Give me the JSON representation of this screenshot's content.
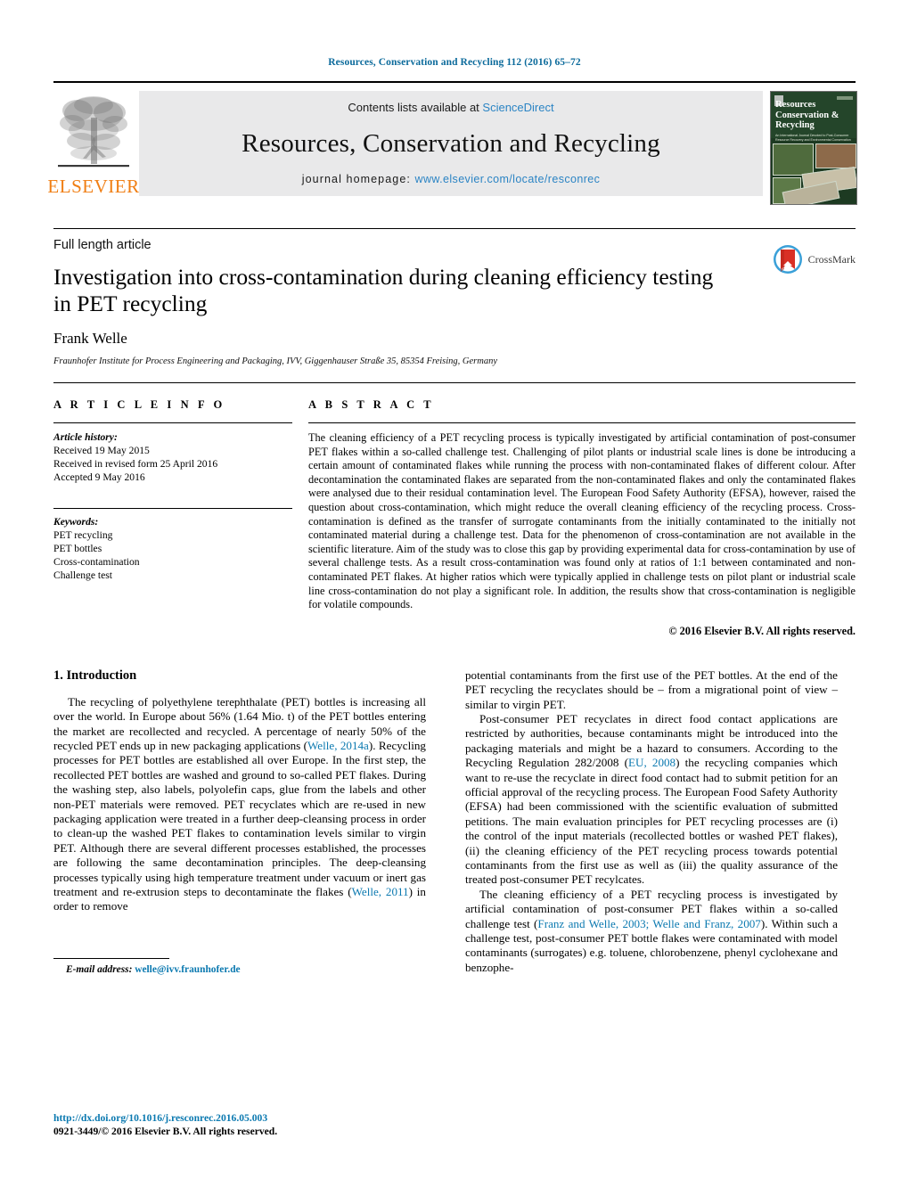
{
  "running_head": "Resources, Conservation and Recycling 112 (2016) 65–72",
  "masthead": {
    "publisher_name": "ELSEVIER",
    "contents_prefix": "Contents lists available at ",
    "contents_link": "ScienceDirect",
    "journal_title": "Resources, Conservation and Recycling",
    "homepage_prefix": "journal homepage: ",
    "homepage_url": "www.elsevier.com/locate/resconrec",
    "cover": {
      "title_line1": "Resources",
      "title_line2": "Conservation &",
      "title_line3": "Recycling",
      "subtitle": "An International Journal Devoted to Post-Consumer Resource Recovery and Environmental Conservation"
    }
  },
  "article": {
    "type": "Full length article",
    "title": "Investigation into cross-contamination during cleaning efficiency testing in PET recycling",
    "author": "Frank Welle",
    "affiliation": "Fraunhofer Institute for Process Engineering and Packaging, IVV, Giggenhauser Straße 35, 85354 Freising, Germany",
    "crossmark_label": "CrossMark"
  },
  "article_info": {
    "heading": "A R T I C L E   I N F O",
    "history_title": "Article history:",
    "history": [
      "Received 19 May 2015",
      "Received in revised form 25 April 2016",
      "Accepted 9 May 2016"
    ],
    "keywords_title": "Keywords:",
    "keywords": [
      "PET recycling",
      "PET bottles",
      "Cross-contamination",
      "Challenge test"
    ]
  },
  "abstract": {
    "heading": "A B S T R A C T",
    "text": "The cleaning efficiency of a PET recycling process is typically investigated by artificial contamination of post-consumer PET flakes within a so-called challenge test. Challenging of pilot plants or industrial scale lines is done be introducing a certain amount of contaminated flakes while running the process with non-contaminated flakes of different colour. After decontamination the contaminated flakes are separated from the non-contaminated flakes and only the contaminated flakes were analysed due to their residual contamination level. The European Food Safety Authority (EFSA), however, raised the question about cross-contamination, which might reduce the overall cleaning efficiency of the recycling process. Cross-contamination is defined as the transfer of surrogate contaminants from the initially contaminated to the initially not contaminated material during a challenge test. Data for the phenomenon of cross-contamination are not available in the scientific literature. Aim of the study was to close this gap by providing experimental data for cross-contamination by use of several challenge tests. As a result cross-contamination was found only at ratios of 1:1 between contaminated and non-contaminated PET flakes. At higher ratios which were typically applied in challenge tests on pilot plant or industrial scale line cross-contamination do not play a significant role. In addition, the results show that cross-contamination is negligible for volatile compounds.",
    "copyright": "© 2016 Elsevier B.V. All rights reserved."
  },
  "body": {
    "section_heading": "1. Introduction",
    "left_p1_a": "The recycling of polyethylene terephthalate (PET) bottles is increasing all over the world. In Europe about 56% (1.64 Mio. t) of the PET bottles entering the market are recollected and recycled. A percentage of nearly 50% of the recycled PET ends up in new packaging applications (",
    "left_p1_ref1": "Welle, 2014a",
    "left_p1_b": "). Recycling processes for PET bottles are established all over Europe. In the first step, the recollected PET bottles are washed and ground to so-called PET flakes. During the washing step, also labels, polyolefin caps, glue from the labels and other non-PET materials were removed. PET recyclates which are re-used in new packaging application were treated in a further deep-cleansing process in order to clean-up the washed PET flakes to contamination levels similar to virgin PET. Although there are several different processes established, the processes are following the same decontamination principles. The deep-cleansing processes typically using high temperature treatment under vacuum or inert gas treatment and re-extrusion steps to decontaminate the flakes (",
    "left_p1_ref2": "Welle, 2011",
    "left_p1_c": ") in order to remove",
    "right_p1": "potential contaminants from the first use of the PET bottles. At the end of the PET recycling the recyclates should be – from a migrational point of view – similar to virgin PET.",
    "right_p2_a": "Post-consumer PET recyclates in direct food contact applications are restricted by authorities, because contaminants might be introduced into the packaging materials and might be a hazard to consumers. According to the Recycling Regulation 282/2008 (",
    "right_p2_ref": "EU, 2008",
    "right_p2_b": ") the recycling companies which want to re-use the recyclate in direct food contact had to submit petition for an official approval of the recycling process. The European Food Safety Authority (EFSA) had been commissioned with the scientific evaluation of submitted petitions. The main evaluation principles for PET recycling processes are (i) the control of the input materials (recollected bottles or washed PET flakes), (ii) the cleaning efficiency of the PET recycling process towards potential contaminants from the first use as well as (iii) the quality assurance of the treated post-consumer PET recylcates.",
    "right_p3_a": "The cleaning efficiency of a PET recycling process is investigated by artificial contamination of post-consumer PET flakes within a so-called challenge test (",
    "right_p3_ref": "Franz and Welle, 2003; Welle and Franz, 2007",
    "right_p3_b": "). Within such a challenge test, post-consumer PET bottle flakes were contaminated with model contaminants (surrogates) e.g. toluene, chlorobenzene, phenyl cyclohexane and benzophe-"
  },
  "footer": {
    "email_label": "E-mail address:",
    "email": "welle@ivv.fraunhofer.de",
    "doi": "http://dx.doi.org/10.1016/j.resconrec.2016.05.003",
    "issn_line": "0921-3449/© 2016 Elsevier B.V. All rights reserved."
  },
  "colors": {
    "link": "#0b79b0",
    "elsevier_orange": "#f07e13",
    "band_gray": "#e9e9ea",
    "cover_green": "#1d3a22"
  }
}
